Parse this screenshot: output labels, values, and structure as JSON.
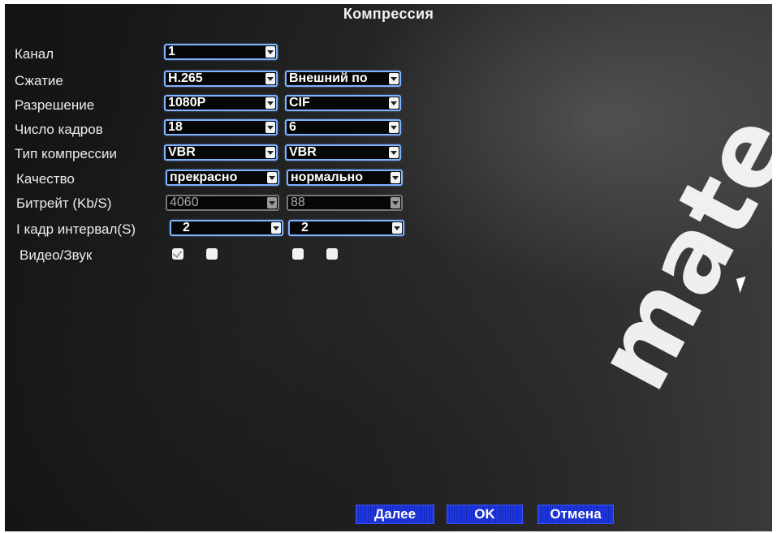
{
  "window": {
    "title": "Компрессия"
  },
  "labels": {
    "channel": "Канал",
    "compression": "Сжатие",
    "resolution": "Разрешение",
    "frame_rate": "Число кадров",
    "bitrate_type": "Тип компрессии",
    "quality": "Качество",
    "bitrate": "Битрейт (Kb/S)",
    "iframe_interval": "I кадр интервал(S)",
    "video_audio": "Видео/Звук"
  },
  "main_stream": {
    "channel": "1",
    "compression": "H.265",
    "resolution": "1080P",
    "frame_rate": "18",
    "bitrate_type": "VBR",
    "quality": "прекрасно",
    "bitrate": "4060",
    "iframe_interval": "2",
    "video_enabled": true,
    "audio_enabled": false
  },
  "extra_stream": {
    "compression": "Внешний по",
    "resolution": "CIF",
    "frame_rate": "6",
    "bitrate_type": "VBR",
    "quality": "нормально",
    "bitrate": "88",
    "iframe_interval": "2",
    "video_enabled": false,
    "audio_enabled": false
  },
  "buttons": {
    "next": "Далее",
    "ok": "OK",
    "cancel": "Отмена"
  },
  "watermark": "mate",
  "colors": {
    "select_border": "#7fb2ff",
    "button_blue": "#1f37e0",
    "background": "#1a1a1a"
  },
  "icons": {
    "cursor": "mouse-pointer-icon",
    "dropdown": "chevron-down-icon"
  }
}
